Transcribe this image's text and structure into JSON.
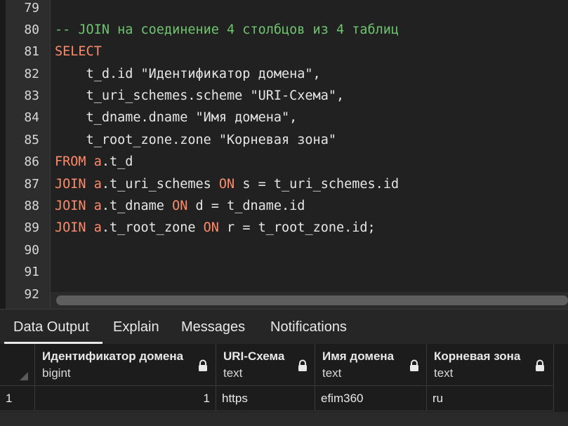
{
  "editor": {
    "lines": [
      {
        "num": "79",
        "text": ""
      },
      {
        "num": "80",
        "text": "-- JOIN на соединение 4 столбцов из 4 таблиц"
      },
      {
        "num": "81",
        "kw": "SELECT"
      },
      {
        "num": "82",
        "text": "    t_d.id \"Идентификатор домена\","
      },
      {
        "num": "83",
        "text": "    t_uri_schemes.scheme \"URI-Схема\","
      },
      {
        "num": "84",
        "text": "    t_dname.dname \"Имя домена\","
      },
      {
        "num": "85",
        "text": "    t_root_zone.zone \"Корневая зона\""
      },
      {
        "num": "86",
        "kw": "FROM",
        "kw2": "a",
        "rest": ".t_d"
      },
      {
        "num": "87",
        "kw": "JOIN",
        "kw2": "a",
        "rest": ".t_uri_schemes ",
        "kw3": "ON",
        "rest2": " s = t_uri_schemes.id"
      },
      {
        "num": "88",
        "kw": "JOIN",
        "kw2": "a",
        "rest": ".t_dname ",
        "kw3": "ON",
        "rest2": " d = t_dname.id"
      },
      {
        "num": "89",
        "kw": "JOIN",
        "kw2": "a",
        "rest": ".t_root_zone ",
        "kw3": "ON",
        "rest2": " r = t_root_zone.id;"
      },
      {
        "num": "90",
        "text": ""
      },
      {
        "num": "91",
        "text": ""
      },
      {
        "num": "92",
        "text": ""
      }
    ]
  },
  "tabs": [
    "Data Output",
    "Explain",
    "Messages",
    "Notifications"
  ],
  "grid": {
    "columns": [
      {
        "name": "Идентификатор домена",
        "type": "bigint"
      },
      {
        "name": "URI-Схема",
        "type": "text"
      },
      {
        "name": "Имя домена",
        "type": "text"
      },
      {
        "name": "Корневая зона",
        "type": "text"
      }
    ],
    "rows": [
      {
        "row_num": "1",
        "cells": [
          "1",
          "https",
          "efim360",
          "ru"
        ]
      }
    ]
  },
  "colors": {
    "keyword": "#ff8a6a",
    "comment": "#6fc56f",
    "text": "#e6e6e6",
    "background": "#212121"
  }
}
